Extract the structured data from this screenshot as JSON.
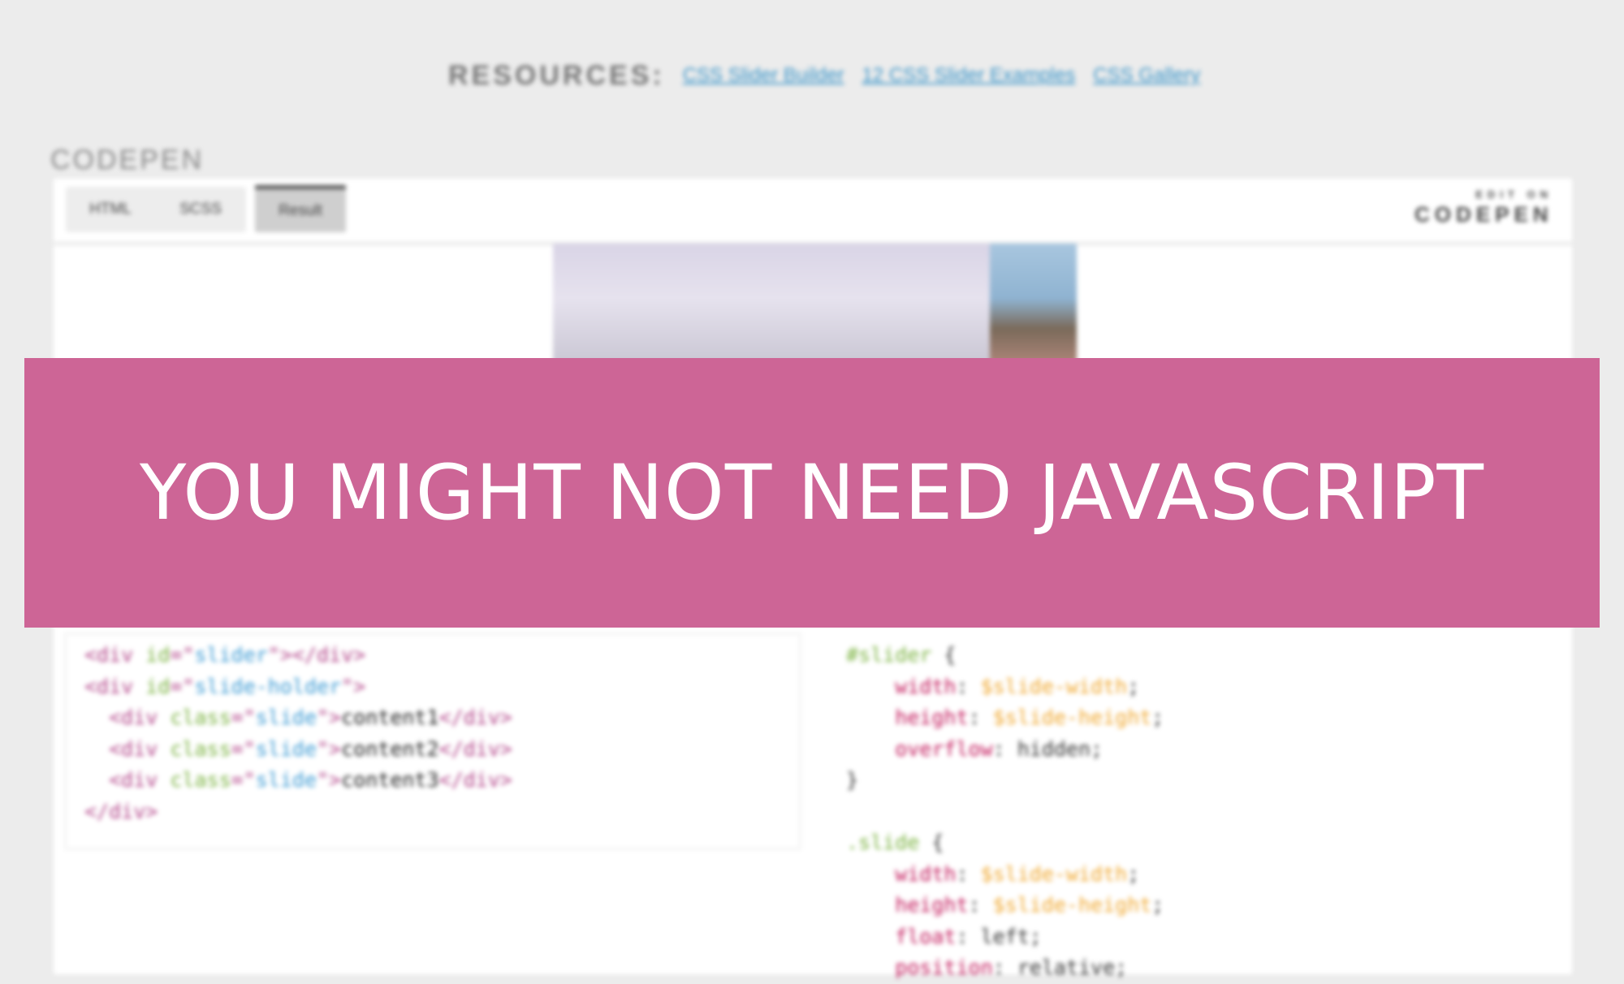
{
  "resources": {
    "label": "RESOURCES:",
    "links": [
      "CSS Slider Builder",
      "12 CSS Slider Examples",
      "CSS Gallery"
    ]
  },
  "codepen_heading": "CODEPEN",
  "pen": {
    "tabs": [
      "HTML",
      "SCSS",
      "Result"
    ],
    "active_tab": "Result",
    "edit_on": {
      "small": "EDIT ON",
      "big": "CODEPEN"
    }
  },
  "html_code": [
    [
      {
        "t": "<div ",
        "c": "tag"
      },
      {
        "t": "id",
        "c": "attr"
      },
      {
        "t": "=\"",
        "c": "tag"
      },
      {
        "t": "slider",
        "c": "str"
      },
      {
        "t": "\"></div>",
        "c": "tag"
      }
    ],
    [
      {
        "t": "<div ",
        "c": "tag"
      },
      {
        "t": "id",
        "c": "attr"
      },
      {
        "t": "=\"",
        "c": "tag"
      },
      {
        "t": "slide-holder",
        "c": "str"
      },
      {
        "t": "\">",
        "c": "tag"
      }
    ],
    [
      {
        "t": "  <div ",
        "c": "tag"
      },
      {
        "t": "class",
        "c": "attr"
      },
      {
        "t": "=\"",
        "c": "tag"
      },
      {
        "t": "slide",
        "c": "str"
      },
      {
        "t": "\">",
        "c": "tag"
      },
      {
        "t": "content1",
        "c": "text"
      },
      {
        "t": "</div>",
        "c": "tag"
      }
    ],
    [
      {
        "t": "  <div ",
        "c": "tag"
      },
      {
        "t": "class",
        "c": "attr"
      },
      {
        "t": "=\"",
        "c": "tag"
      },
      {
        "t": "slide",
        "c": "str"
      },
      {
        "t": "\">",
        "c": "tag"
      },
      {
        "t": "content2",
        "c": "text"
      },
      {
        "t": "</div>",
        "c": "tag"
      }
    ],
    [
      {
        "t": "  <div ",
        "c": "tag"
      },
      {
        "t": "class",
        "c": "attr"
      },
      {
        "t": "=\"",
        "c": "tag"
      },
      {
        "t": "slide",
        "c": "str"
      },
      {
        "t": "\">",
        "c": "tag"
      },
      {
        "t": "content3",
        "c": "text"
      },
      {
        "t": "</div>",
        "c": "tag"
      }
    ],
    [
      {
        "t": "</div>",
        "c": "tag"
      }
    ]
  ],
  "scss_code": [
    [
      {
        "t": "#slider",
        "c": "sel"
      },
      {
        "t": " {",
        "c": "plain"
      }
    ],
    [
      {
        "t": "    width",
        "c": "prop"
      },
      {
        "t": ": ",
        "c": "plain"
      },
      {
        "t": "$slide-width",
        "c": "var"
      },
      {
        "t": ";",
        "c": "plain"
      }
    ],
    [
      {
        "t": "    height",
        "c": "prop"
      },
      {
        "t": ": ",
        "c": "plain"
      },
      {
        "t": "$slide-height",
        "c": "var"
      },
      {
        "t": ";",
        "c": "plain"
      }
    ],
    [
      {
        "t": "    overflow",
        "c": "prop"
      },
      {
        "t": ": hidden;",
        "c": "plain"
      }
    ],
    [
      {
        "t": "}",
        "c": "plain"
      }
    ],
    [
      {
        "t": "",
        "c": "plain"
      }
    ],
    [
      {
        "t": ".slide",
        "c": "sel"
      },
      {
        "t": " {",
        "c": "plain"
      }
    ],
    [
      {
        "t": "    width",
        "c": "prop"
      },
      {
        "t": ": ",
        "c": "plain"
      },
      {
        "t": "$slide-width",
        "c": "var"
      },
      {
        "t": ";",
        "c": "plain"
      }
    ],
    [
      {
        "t": "    height",
        "c": "prop"
      },
      {
        "t": ": ",
        "c": "plain"
      },
      {
        "t": "$slide-height",
        "c": "var"
      },
      {
        "t": ";",
        "c": "plain"
      }
    ],
    [
      {
        "t": "    float",
        "c": "prop"
      },
      {
        "t": ": left;",
        "c": "plain"
      }
    ],
    [
      {
        "t": "    position",
        "c": "prop"
      },
      {
        "t": ": relative;",
        "c": "plain"
      }
    ]
  ],
  "banner": {
    "title": "YOU MIGHT NOT NEED JAVASCRIPT",
    "color": "#cd6596"
  },
  "colors": {
    "link": "#3a95c9",
    "background": "#ececec"
  }
}
